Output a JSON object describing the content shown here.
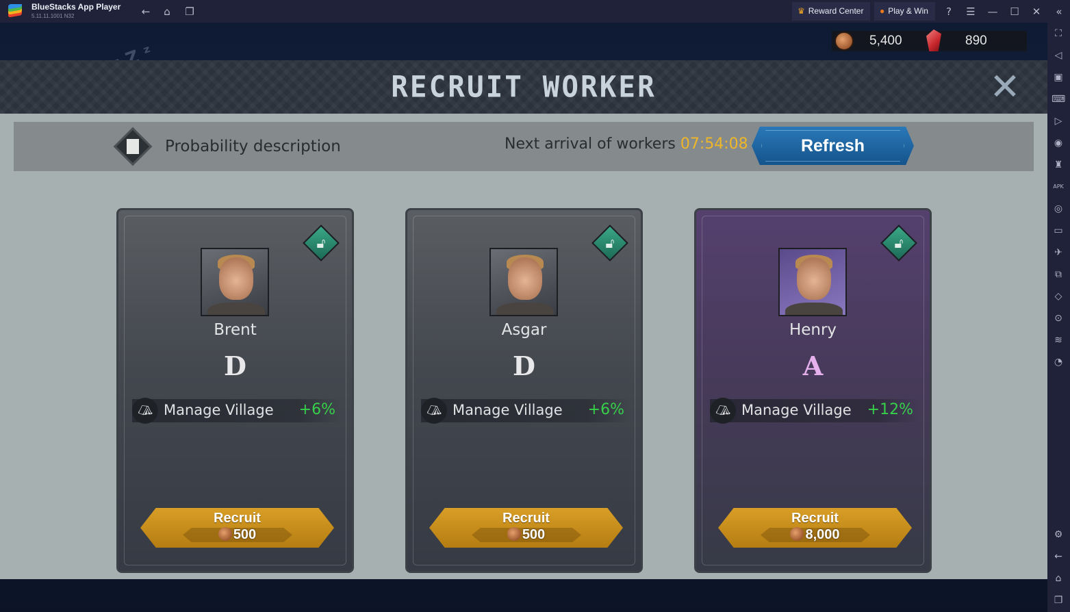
{
  "window": {
    "app_name": "BlueStacks App Player",
    "version": "5.11.11.1001 N32",
    "reward_center": "Reward Center",
    "play_win": "Play & Win"
  },
  "resources": {
    "coins": "5,400",
    "gems": "890"
  },
  "dialog": {
    "title": "RECRUIT WORKER",
    "probability_label": "Probability description",
    "arrival_label": "Next arrival of workers",
    "arrival_time": "07:54:08",
    "refresh_label": "Refresh"
  },
  "workers": [
    {
      "name": "Brent",
      "grade": "D",
      "skill": "Manage Village",
      "bonus": "+6%",
      "recruit_label": "Recruit",
      "cost": "500",
      "rarity": "grey",
      "grade_color": "#e8e8ea"
    },
    {
      "name": "Asgar",
      "grade": "D",
      "skill": "Manage Village",
      "bonus": "+6%",
      "recruit_label": "Recruit",
      "cost": "500",
      "rarity": "grey",
      "grade_color": "#e8e8ea"
    },
    {
      "name": "Henry",
      "grade": "A",
      "skill": "Manage Village",
      "bonus": "+12%",
      "recruit_label": "Recruit",
      "cost": "8,000",
      "rarity": "purple",
      "grade_color": "#e6b0ec"
    }
  ],
  "sidebar_icons": [
    "fullscreen-icon",
    "volume-mute-icon",
    "pointer-icon",
    "keyboard-icon",
    "macro-play-icon",
    "rotate-icon",
    "performance-icon",
    "apk-install-icon",
    "screenshot-icon",
    "folder-icon",
    "airplane-icon",
    "multi-instance-icon",
    "shake-icon",
    "location-icon",
    "layers-icon",
    "speed-icon"
  ],
  "sidebar_bottom_icons": [
    "settings-icon",
    "back-icon",
    "home-icon",
    "recents-icon"
  ]
}
